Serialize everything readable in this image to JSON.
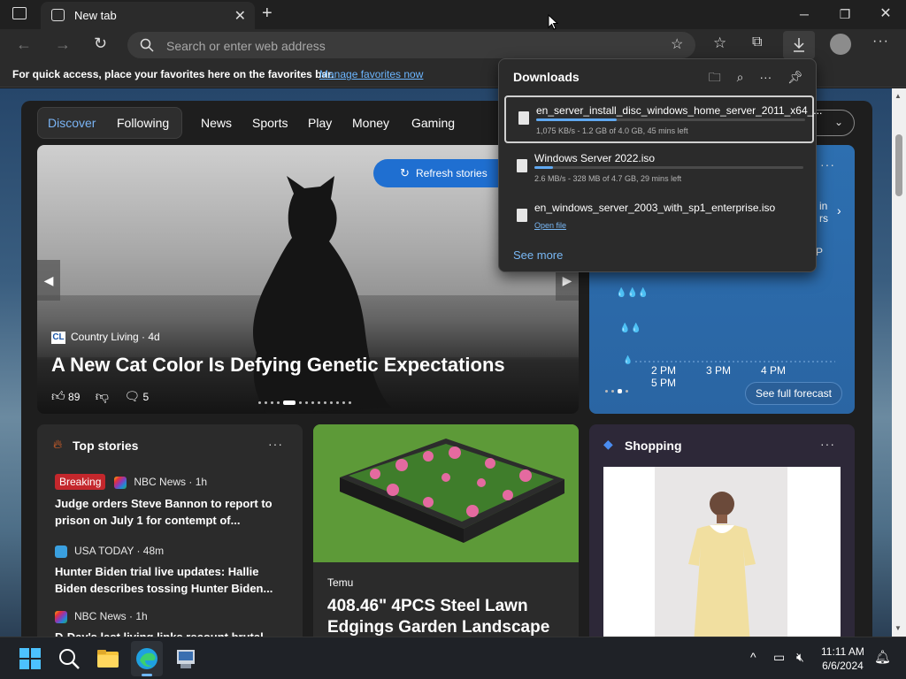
{
  "browser": {
    "tab_title": "New tab",
    "address_placeholder": "Search or enter web address"
  },
  "favorites_bar": {
    "message": "For quick access, place your favorites here on the favorites bar.",
    "link": "Manage favorites now"
  },
  "feed_nav": {
    "items": [
      "Discover",
      "Following",
      "News",
      "Sports",
      "Play",
      "Money",
      "Gaming"
    ]
  },
  "hero": {
    "refresh_label": "Refresh stories",
    "source": "Country Living · 4d",
    "source_logo": "CL",
    "headline": "A New Cat Color Is Defying Genetic Expectations",
    "likes": "89",
    "comments": "5"
  },
  "weather": {
    "partial_text_1": "in",
    "partial_text_2": "rs",
    "partial_text_3": "P",
    "times": [
      "2 PM",
      "3 PM",
      "4 PM",
      "5 PM"
    ],
    "forecast_label": "See full forecast"
  },
  "top_stories": {
    "title": "Top stories",
    "stories": [
      {
        "badge": "Breaking",
        "source": "NBC News · 1h",
        "text": "Judge orders Steve Bannon to report to prison on July 1 for contempt of..."
      },
      {
        "source": "USA TODAY · 48m",
        "text": "Hunter Biden trial live updates: Hallie Biden describes tossing Hunter Biden..."
      },
      {
        "source": "NBC News · 1h",
        "text": "D-Day's last living links recount brutal"
      }
    ]
  },
  "promo": {
    "source": "Temu",
    "headline": "408.46\" 4PCS Steel Lawn Edgings Garden Landscape"
  },
  "shopping": {
    "title": "Shopping"
  },
  "downloads": {
    "title": "Downloads",
    "items": [
      {
        "name": "en_server_install_disc_windows_home_server_2011_x64_...",
        "status": "1,075 KB/s - 1.2 GB of 4.0 GB, 45 mins left",
        "progress": 0.3
      },
      {
        "name": "Windows Server 2022.iso",
        "status": "2.6 MB/s - 328 MB of 4.7 GB, 29 mins left",
        "progress": 0.07
      },
      {
        "name": "en_windows_server_2003_with_sp1_enterprise.iso",
        "action": "Open file"
      }
    ],
    "see_more": "See more"
  },
  "taskbar": {
    "time": "11:11 AM",
    "date": "6/6/2024"
  }
}
